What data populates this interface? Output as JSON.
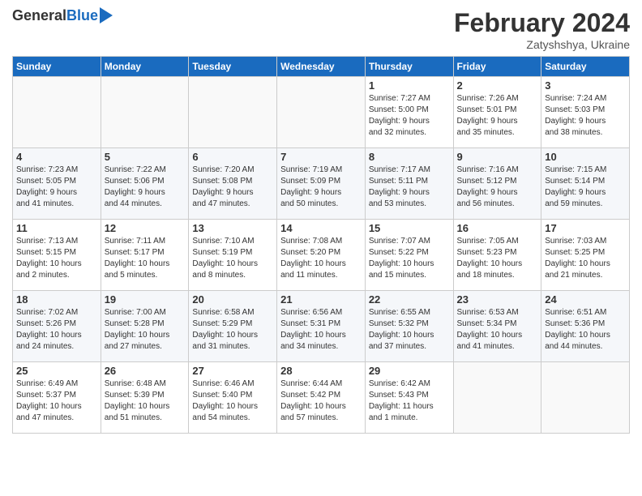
{
  "header": {
    "logo_general": "General",
    "logo_blue": "Blue",
    "month_title": "February 2024",
    "location": "Zatyshshya, Ukraine"
  },
  "weekdays": [
    "Sunday",
    "Monday",
    "Tuesday",
    "Wednesday",
    "Thursday",
    "Friday",
    "Saturday"
  ],
  "weeks": [
    [
      {
        "day": "",
        "info": ""
      },
      {
        "day": "",
        "info": ""
      },
      {
        "day": "",
        "info": ""
      },
      {
        "day": "",
        "info": ""
      },
      {
        "day": "1",
        "info": "Sunrise: 7:27 AM\nSunset: 5:00 PM\nDaylight: 9 hours\nand 32 minutes."
      },
      {
        "day": "2",
        "info": "Sunrise: 7:26 AM\nSunset: 5:01 PM\nDaylight: 9 hours\nand 35 minutes."
      },
      {
        "day": "3",
        "info": "Sunrise: 7:24 AM\nSunset: 5:03 PM\nDaylight: 9 hours\nand 38 minutes."
      }
    ],
    [
      {
        "day": "4",
        "info": "Sunrise: 7:23 AM\nSunset: 5:05 PM\nDaylight: 9 hours\nand 41 minutes."
      },
      {
        "day": "5",
        "info": "Sunrise: 7:22 AM\nSunset: 5:06 PM\nDaylight: 9 hours\nand 44 minutes."
      },
      {
        "day": "6",
        "info": "Sunrise: 7:20 AM\nSunset: 5:08 PM\nDaylight: 9 hours\nand 47 minutes."
      },
      {
        "day": "7",
        "info": "Sunrise: 7:19 AM\nSunset: 5:09 PM\nDaylight: 9 hours\nand 50 minutes."
      },
      {
        "day": "8",
        "info": "Sunrise: 7:17 AM\nSunset: 5:11 PM\nDaylight: 9 hours\nand 53 minutes."
      },
      {
        "day": "9",
        "info": "Sunrise: 7:16 AM\nSunset: 5:12 PM\nDaylight: 9 hours\nand 56 minutes."
      },
      {
        "day": "10",
        "info": "Sunrise: 7:15 AM\nSunset: 5:14 PM\nDaylight: 9 hours\nand 59 minutes."
      }
    ],
    [
      {
        "day": "11",
        "info": "Sunrise: 7:13 AM\nSunset: 5:15 PM\nDaylight: 10 hours\nand 2 minutes."
      },
      {
        "day": "12",
        "info": "Sunrise: 7:11 AM\nSunset: 5:17 PM\nDaylight: 10 hours\nand 5 minutes."
      },
      {
        "day": "13",
        "info": "Sunrise: 7:10 AM\nSunset: 5:19 PM\nDaylight: 10 hours\nand 8 minutes."
      },
      {
        "day": "14",
        "info": "Sunrise: 7:08 AM\nSunset: 5:20 PM\nDaylight: 10 hours\nand 11 minutes."
      },
      {
        "day": "15",
        "info": "Sunrise: 7:07 AM\nSunset: 5:22 PM\nDaylight: 10 hours\nand 15 minutes."
      },
      {
        "day": "16",
        "info": "Sunrise: 7:05 AM\nSunset: 5:23 PM\nDaylight: 10 hours\nand 18 minutes."
      },
      {
        "day": "17",
        "info": "Sunrise: 7:03 AM\nSunset: 5:25 PM\nDaylight: 10 hours\nand 21 minutes."
      }
    ],
    [
      {
        "day": "18",
        "info": "Sunrise: 7:02 AM\nSunset: 5:26 PM\nDaylight: 10 hours\nand 24 minutes."
      },
      {
        "day": "19",
        "info": "Sunrise: 7:00 AM\nSunset: 5:28 PM\nDaylight: 10 hours\nand 27 minutes."
      },
      {
        "day": "20",
        "info": "Sunrise: 6:58 AM\nSunset: 5:29 PM\nDaylight: 10 hours\nand 31 minutes."
      },
      {
        "day": "21",
        "info": "Sunrise: 6:56 AM\nSunset: 5:31 PM\nDaylight: 10 hours\nand 34 minutes."
      },
      {
        "day": "22",
        "info": "Sunrise: 6:55 AM\nSunset: 5:32 PM\nDaylight: 10 hours\nand 37 minutes."
      },
      {
        "day": "23",
        "info": "Sunrise: 6:53 AM\nSunset: 5:34 PM\nDaylight: 10 hours\nand 41 minutes."
      },
      {
        "day": "24",
        "info": "Sunrise: 6:51 AM\nSunset: 5:36 PM\nDaylight: 10 hours\nand 44 minutes."
      }
    ],
    [
      {
        "day": "25",
        "info": "Sunrise: 6:49 AM\nSunset: 5:37 PM\nDaylight: 10 hours\nand 47 minutes."
      },
      {
        "day": "26",
        "info": "Sunrise: 6:48 AM\nSunset: 5:39 PM\nDaylight: 10 hours\nand 51 minutes."
      },
      {
        "day": "27",
        "info": "Sunrise: 6:46 AM\nSunset: 5:40 PM\nDaylight: 10 hours\nand 54 minutes."
      },
      {
        "day": "28",
        "info": "Sunrise: 6:44 AM\nSunset: 5:42 PM\nDaylight: 10 hours\nand 57 minutes."
      },
      {
        "day": "29",
        "info": "Sunrise: 6:42 AM\nSunset: 5:43 PM\nDaylight: 11 hours\nand 1 minute."
      },
      {
        "day": "",
        "info": ""
      },
      {
        "day": "",
        "info": ""
      }
    ]
  ]
}
